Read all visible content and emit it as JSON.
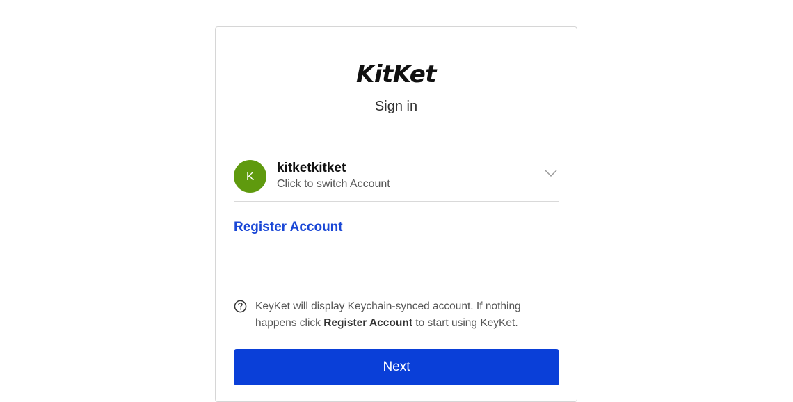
{
  "brand": {
    "logo_text": "KitKet"
  },
  "header": {
    "subtitle": "Sign in"
  },
  "account": {
    "avatar_initial": "K",
    "avatar_color": "#5f9a0e",
    "name": "kitketkitket",
    "hint": "Click to switch Account",
    "chevron_icon": "chevron-down-icon"
  },
  "register": {
    "link_label": "Register Account"
  },
  "info": {
    "icon": "question-circle-icon",
    "text_before": "KeyKet will display Keychain-synced account. If nothing happens click ",
    "text_bold": "Register Account",
    "text_after": " to start using KeyKet."
  },
  "actions": {
    "next_label": "Next",
    "next_color": "#0a3fd8"
  },
  "colors": {
    "link": "#1a47d6",
    "border": "#d6d6d6"
  }
}
